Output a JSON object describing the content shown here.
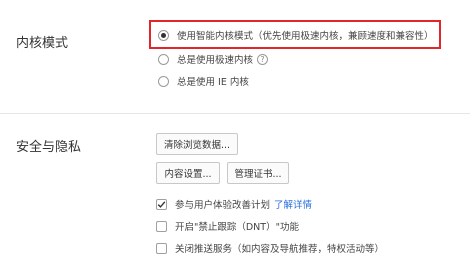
{
  "kernel_mode": {
    "label": "内核模式",
    "options": [
      {
        "label": "使用智能内核模式（优先使用极速内核，兼顾速度和兼容性）",
        "selected": true
      },
      {
        "label": "总是使用极速内核",
        "selected": false
      },
      {
        "label": "总是使用 IE 内核",
        "selected": false
      }
    ],
    "help_icon_glyph": "?"
  },
  "security": {
    "label": "安全与隐私",
    "clear_data_button": "清除浏览数据...",
    "content_settings_button": "内容设置...",
    "manage_certs_button": "管理证书...",
    "checkboxes": [
      {
        "label": "参与用户体验改善计划",
        "checked": true
      },
      {
        "label": "开启\"禁止跟踪（DNT）\"功能",
        "checked": false
      },
      {
        "label": "关闭推送服务（如内容及导航推荐，特权活动等）",
        "checked": false
      }
    ],
    "learn_more_link": "了解详情"
  },
  "colors": {
    "highlight": "#e0262a",
    "link": "#2a6fdb"
  }
}
